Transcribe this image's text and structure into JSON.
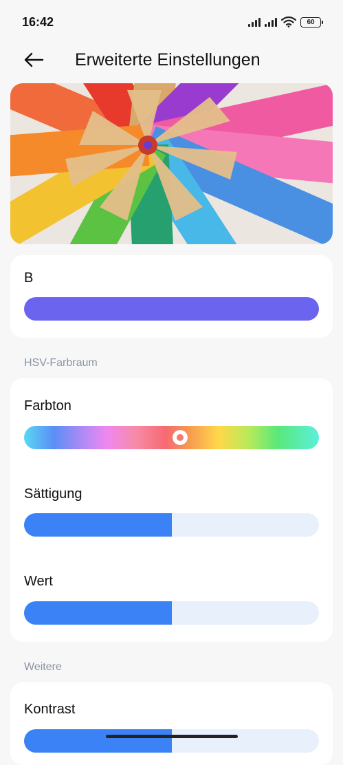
{
  "status": {
    "time": "16:42",
    "battery": "60",
    "icons": [
      "signal-icon",
      "signal-icon",
      "wifi-icon",
      "battery-icon"
    ]
  },
  "header": {
    "title": "Erweiterte Einstellungen",
    "back_icon": "arrow-left-icon"
  },
  "rgb": {
    "b_label": "B",
    "b_color": "#6a64ef"
  },
  "hsv": {
    "section_label": "HSV-Farbraum",
    "hue_label": "Farbton",
    "hue_position": 0.53,
    "saturation_label": "Sättigung",
    "saturation_value": 0.5,
    "value_label": "Wert",
    "value_value": 0.5
  },
  "other": {
    "section_label": "Weitere",
    "contrast_label": "Kontrast",
    "contrast_value": 0.5
  },
  "colors": {
    "accent": "#3b82f6",
    "track": "#e8f0fc",
    "section_text": "#8a94a6"
  }
}
